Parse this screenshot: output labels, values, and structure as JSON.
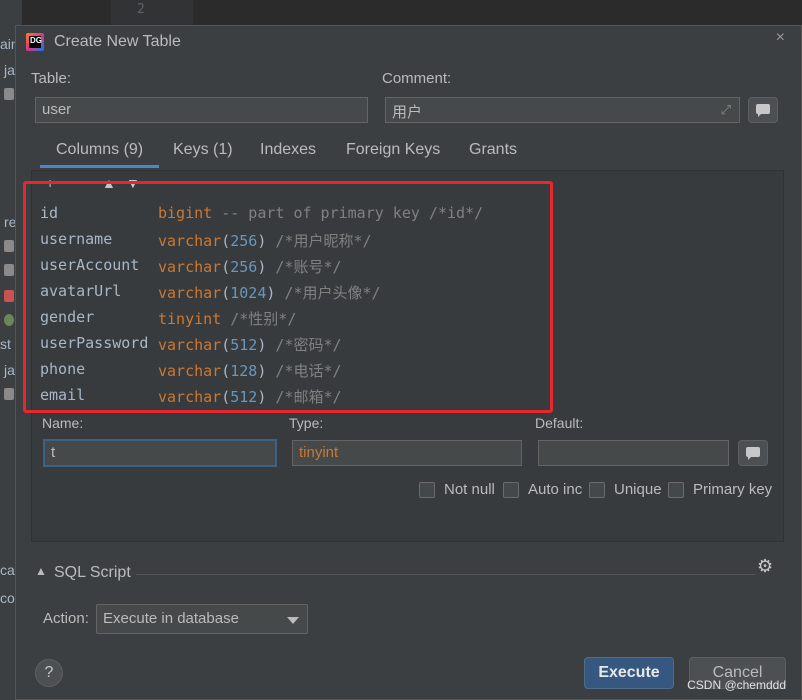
{
  "background": {
    "line_number": "2",
    "fragments": [
      "ain",
      "ja",
      "re",
      "st",
      "ja",
      "ca",
      "cor"
    ]
  },
  "dialog": {
    "title": "Create New Table",
    "table_label": "Table:",
    "table_value": "user",
    "comment_label": "Comment:",
    "comment_value": "用户",
    "tabs": [
      {
        "label": "Columns (9)",
        "active": true
      },
      {
        "label": "Keys (1)"
      },
      {
        "label": "Indexes"
      },
      {
        "label": "Foreign Keys"
      },
      {
        "label": "Grants"
      }
    ],
    "toolbar": {
      "add": "+",
      "remove": "−",
      "up": "▲",
      "down": "▼"
    },
    "columns": [
      {
        "name": "id",
        "type": "bigint",
        "args": "",
        "comment": " -- part of primary key /*id*/"
      },
      {
        "name": "username",
        "type": "varchar",
        "args": "256",
        "comment": " /*用户昵称*/"
      },
      {
        "name": "userAccount",
        "type": "varchar",
        "args": "256",
        "comment": " /*账号*/"
      },
      {
        "name": "avatarUrl",
        "type": "varchar",
        "args": "1024",
        "comment": " /*用户头像*/"
      },
      {
        "name": "gender",
        "type": "tinyint",
        "args": "",
        "comment": " /*性别*/"
      },
      {
        "name": "userPassword",
        "type": "varchar",
        "args": "512",
        "comment": " /*密码*/"
      },
      {
        "name": "phone",
        "type": "varchar",
        "args": "128",
        "comment": " /*电话*/"
      },
      {
        "name": "email",
        "type": "varchar",
        "args": "512",
        "comment": " /*邮箱*/"
      }
    ],
    "editor": {
      "name_label": "Name:",
      "name_value": "t",
      "type_label": "Type:",
      "type_value": "tinyint",
      "default_label": "Default:",
      "default_value": ""
    },
    "checkboxes": [
      {
        "label": "Not null",
        "checked": false
      },
      {
        "label": "Auto inc",
        "checked": false
      },
      {
        "label": "Unique",
        "checked": false
      },
      {
        "label": "Primary key",
        "checked": false
      }
    ],
    "sql_section_label": "SQL Script",
    "action_label": "Action:",
    "action_value": "Execute in database",
    "help_label": "?",
    "execute_label": "Execute",
    "cancel_label": "Cancel"
  },
  "watermark": "CSDN @chemddd",
  "colors": {
    "keyword": "#cc7832",
    "number": "#6897bb",
    "comment": "#808080",
    "highlight": "#e8262d",
    "primary_button": "#365880"
  }
}
